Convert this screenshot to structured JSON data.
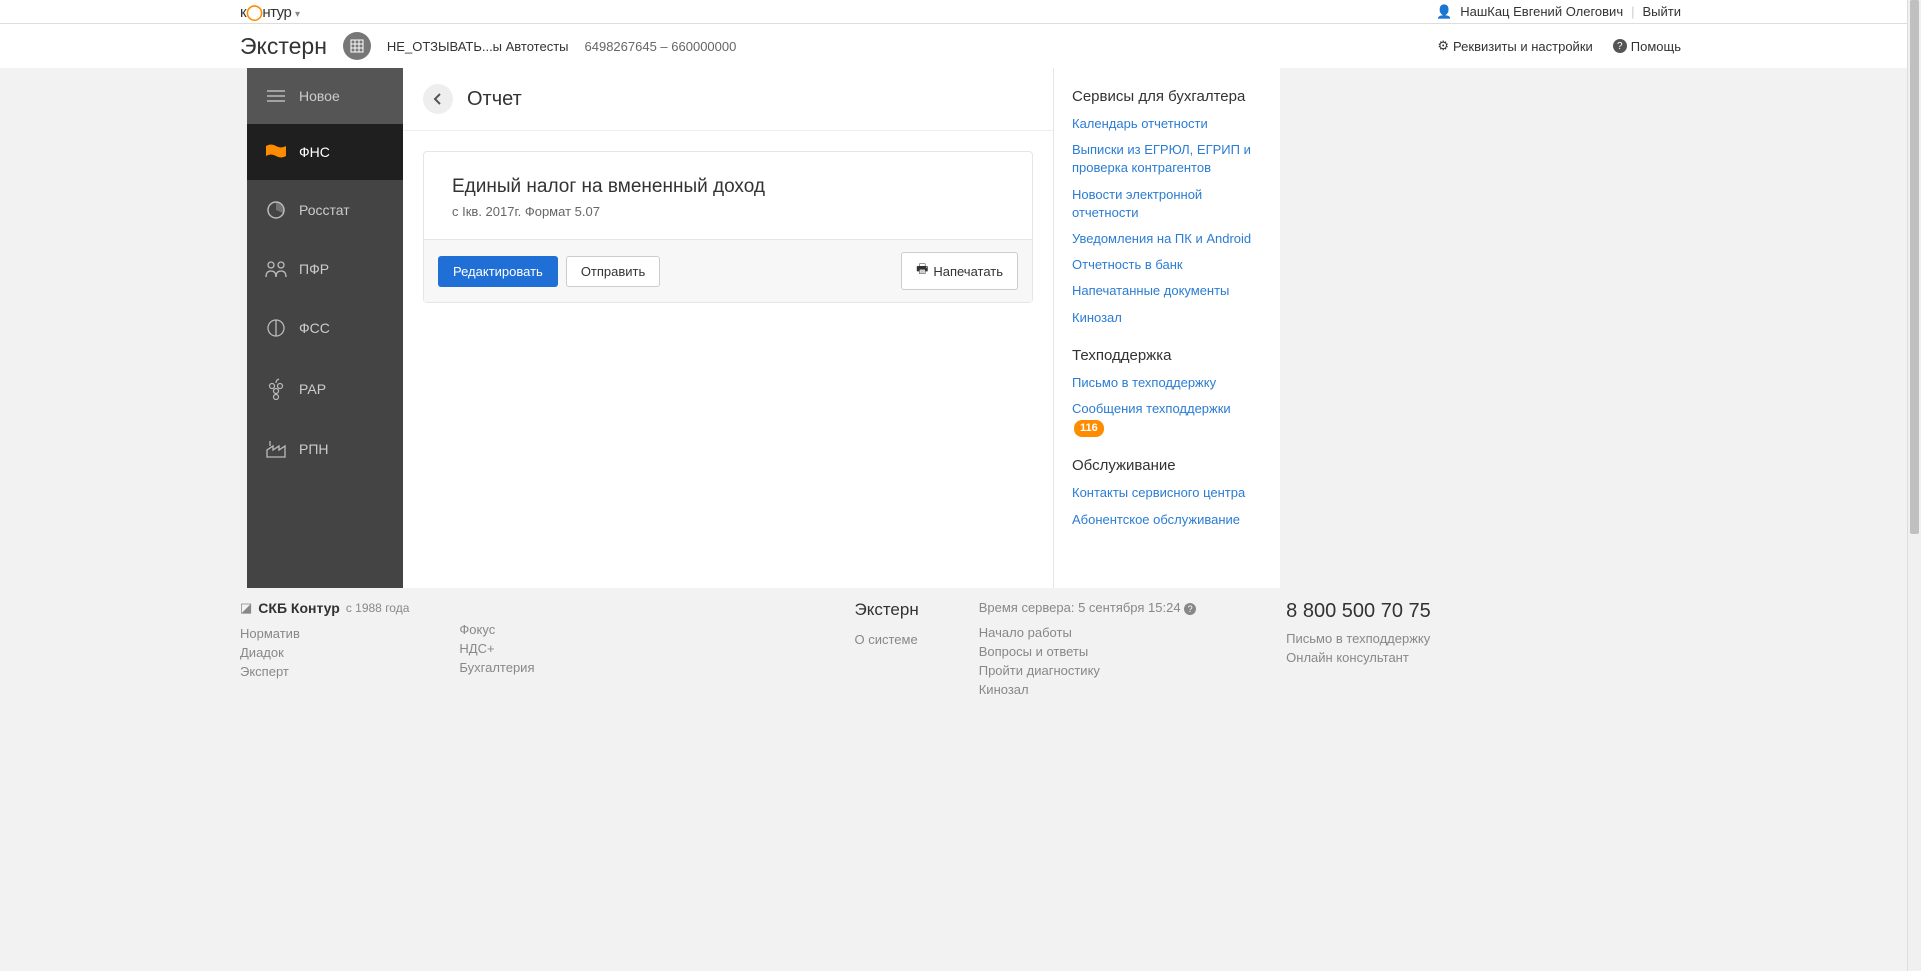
{
  "topbar": {
    "logo_pre": "к",
    "logo_post": "нтур",
    "user_name": "НашКац Евгений Олегович",
    "logout": "Выйти"
  },
  "header": {
    "app_title": "Экстерн",
    "org_name": "НЕ_ОТЗЫВАТЬ...ы Автотесты",
    "org_numbers": "6498267645 – 660000000",
    "settings": "Реквизиты и настройки",
    "help": "Помощь"
  },
  "sidebar": {
    "new": "Новое",
    "fns": "ФНС",
    "rosstat": "Росстат",
    "pfr": "ПФР",
    "fss": "ФСС",
    "rar": "РАР",
    "rpn": "РПН"
  },
  "page": {
    "title": "Отчет",
    "report_title": "Единый налог на вмененный доход",
    "report_subtitle": "с Iкв. 2017г. Формат 5.07",
    "edit": "Редактировать",
    "send": "Отправить",
    "print": "Напечатать"
  },
  "panel": {
    "services_heading": "Сервисы для бухгалтера",
    "link_calendar": "Календарь отчетности",
    "link_egr": "Выписки из ЕГРЮЛ, ЕГРИП и проверка контрагентов",
    "link_news": "Новости электронной отчетности",
    "link_notify": "Уведомления на ПК и Android",
    "link_bank": "Отчетность в банк",
    "link_printed": "Напечатанные документы",
    "link_cinema": "Кинозал",
    "support_heading": "Техподдержка",
    "link_support_letter": "Письмо в техподдержку",
    "link_support_msgs": "Сообщения техподдержки",
    "support_badge": "116",
    "service_heading": "Обслуживание",
    "link_contacts": "Контакты сервисного центра",
    "link_subscription": "Абонентское обслуживание"
  },
  "footer": {
    "brand": "СКБ Контур",
    "since": "с 1988 года",
    "normativ": "Норматив",
    "diadok": "Диадок",
    "expert": "Эксперт",
    "fokus": "Фокус",
    "nds": "НДС+",
    "buh": "Бухгалтерия",
    "extern": "Экстерн",
    "about": "О системе",
    "server_time": "Время сервера: 5 сентября 15:24",
    "start": "Начало работы",
    "qa": "Вопросы и ответы",
    "diag": "Пройти диагностику",
    "cinema2": "Кинозал",
    "phone": "8 800 500 70 75",
    "support_letter": "Письмо в техподдержку",
    "online": "Онлайн консультант"
  }
}
